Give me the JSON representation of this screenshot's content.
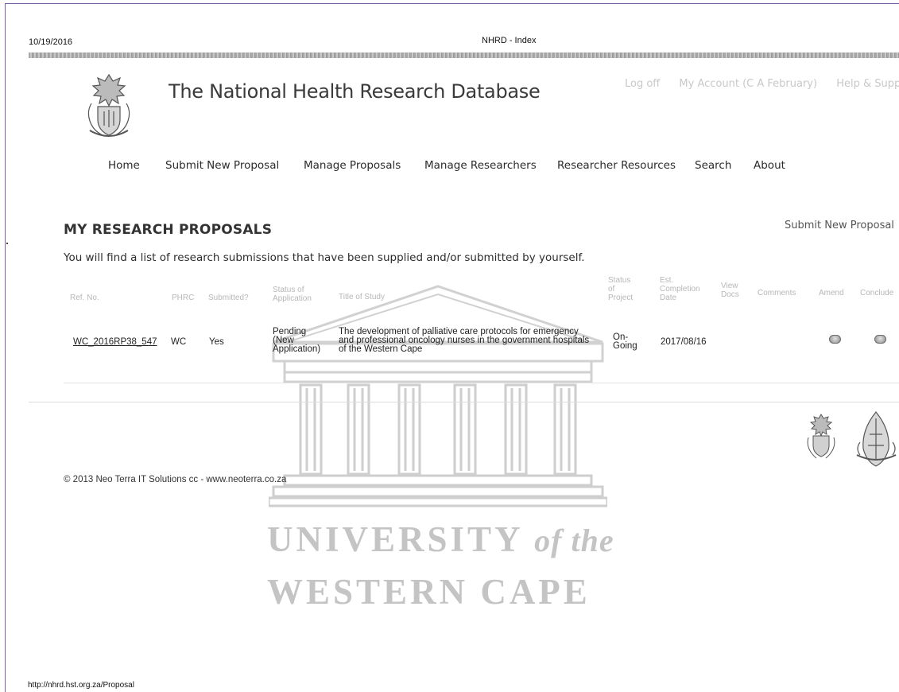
{
  "print_header": {
    "date": "10/19/2016",
    "title": "NHRD - Index"
  },
  "site": {
    "title": "The National Health Research Database"
  },
  "top_links": [
    "Log off",
    "My Account (C A February)",
    "Help & Support"
  ],
  "nav": [
    "Home",
    "Submit New Proposal",
    "Manage Proposals",
    "Manage Researchers",
    "Researcher Resources",
    "Search",
    "About"
  ],
  "page": {
    "heading": "MY RESEARCH PROPOSALS",
    "submit_link": "Submit New Proposal",
    "intro": "You will find a list of research submissions that have been supplied and/or submitted by yourself."
  },
  "table": {
    "headers": {
      "ref": "Ref. No.",
      "phrc": "PHRC",
      "submitted": "Submitted?",
      "status_app_1": "Status of",
      "status_app_2": "Application",
      "title": "Title of Study",
      "status_proj_1": "Status",
      "status_proj_2": "of",
      "status_proj_3": "Project",
      "est_1": "Est.",
      "est_2": "Completion",
      "est_3": "Date",
      "view_1": "View",
      "view_2": "Docs",
      "comments": "Comments",
      "amend": "Amend",
      "conclude": "Conclude"
    },
    "rows": [
      {
        "ref": "WC_2016RP38_547",
        "phrc": "WC",
        "submitted": "Yes",
        "status_app_1": "Pending",
        "status_app_2": "(New",
        "status_app_3": "Application)",
        "title_1": "The development of palliative care protocols for emergency",
        "title_2": "and professional oncology nurses in the government hospitals",
        "title_3": "of the Western Cape",
        "status_proj_1": "On-",
        "status_proj_2": "Going",
        "est_date": "2017/08/16"
      }
    ]
  },
  "footer": {
    "copyright": "© 2013 Neo Terra IT Solutions cc -  www.neoterra.co.za"
  },
  "watermark": {
    "line1_main": "UNIVERSITY",
    "line1_italic": "of the",
    "line2": "WESTERN CAPE"
  },
  "status_bar": {
    "url": "http://nhrd.hst.org.za/Proposal"
  }
}
